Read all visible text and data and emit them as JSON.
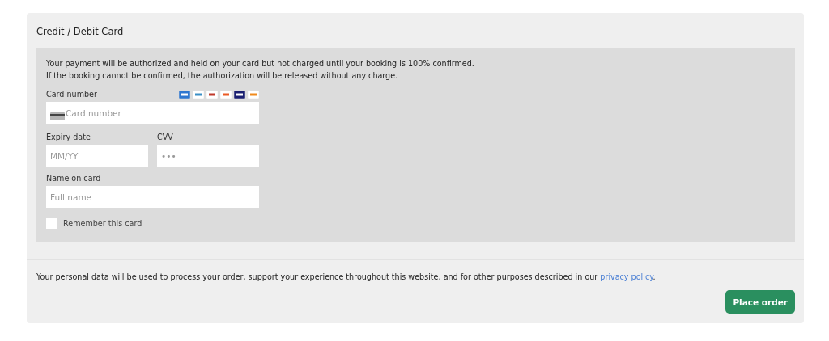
{
  "title": "Credit / Debit Card",
  "notice": [
    "Your payment will be authorized and held on your card but not charged until your booking is 100% confirmed.",
    "If the booking cannot be confirmed, the authorization will be released without any charge."
  ],
  "card_number": {
    "label": "Card number",
    "placeholder": "Card number"
  },
  "expiry": {
    "label": "Expiry date",
    "placeholder": "MM/YY"
  },
  "cvv": {
    "label": "CVV",
    "placeholder": "•••"
  },
  "name_on_card": {
    "label": "Name on card",
    "placeholder": "Full name"
  },
  "remember": {
    "label": "Remember this card",
    "checked": false
  },
  "privacy": {
    "text": "Your personal data will be used to process your order, support your experience throughout this website, and for other purposes described in our",
    "link": "privacy policy",
    "end": "."
  },
  "button": "Place order"
}
